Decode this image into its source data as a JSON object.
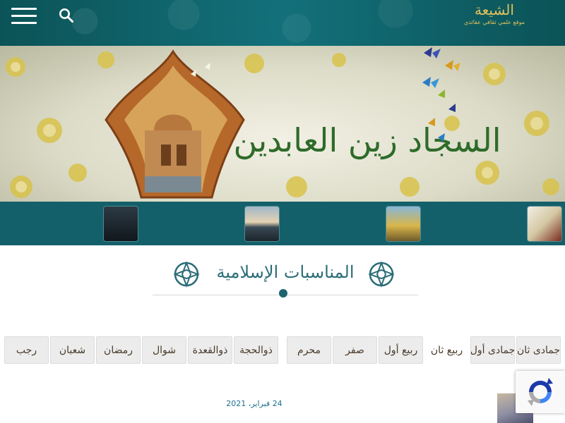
{
  "header": {
    "logo_mark": "الشيعة",
    "logo_tagline": "موقع علمي ثقافي عقائدي"
  },
  "banner": {
    "calligraphy": "السجاد زين العابدين"
  },
  "section": {
    "title": "المناسبات الإسلامية"
  },
  "months": [
    {
      "label": "رجب"
    },
    {
      "label": "شعبان"
    },
    {
      "label": "رمضان"
    },
    {
      "label": "شوال"
    },
    {
      "label": "ذوالقعدة"
    },
    {
      "label": "ذوالحجة"
    },
    {
      "label": "محرم"
    },
    {
      "label": "صفر"
    },
    {
      "label": "ربيع أول"
    },
    {
      "label": "ربيع ثان"
    },
    {
      "label": "جمادى أول"
    },
    {
      "label": "جمادى ثان"
    }
  ],
  "post": {
    "date": "24 فبراير، 2021"
  },
  "colors": {
    "header_bg": "#0d5e63",
    "strip_bg": "#14606a",
    "title_color": "#2b6d78",
    "date_color": "#1d6f8e"
  },
  "icons": [
    "menu-icon",
    "search-icon",
    "ornament-icon",
    "recaptcha-icon"
  ]
}
